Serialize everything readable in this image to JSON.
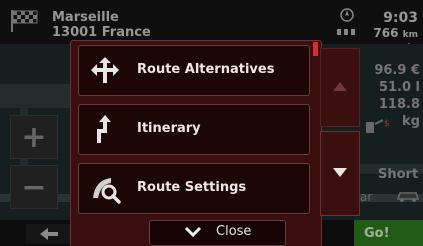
{
  "destination": {
    "city": "Marseille",
    "address": "13001 France"
  },
  "status": {
    "time": "9:03",
    "distance_value": "766",
    "distance_unit": "km",
    "eta_placeholder": "--:--"
  },
  "trip_info": {
    "cost": "96.9 €",
    "fuel": "51.0 l",
    "co2": "118.8 kg",
    "route_mode": "Short",
    "partial_label": "ar"
  },
  "menu": {
    "items": [
      {
        "label": "Route Alternatives",
        "icon": "route-alternatives-icon"
      },
      {
        "label": "Itinerary",
        "icon": "itinerary-icon"
      },
      {
        "label": "Route Settings",
        "icon": "route-settings-icon"
      }
    ],
    "close_label": "Close"
  },
  "map_controls": {
    "zoom_in": "+",
    "zoom_out": "−"
  },
  "go_label": "Go!",
  "colors": {
    "menu_bg": "#3b0f0f",
    "item_bg": "#1c0606",
    "accent_red": "#d42f2f",
    "go_green": "#2e7a1e"
  }
}
